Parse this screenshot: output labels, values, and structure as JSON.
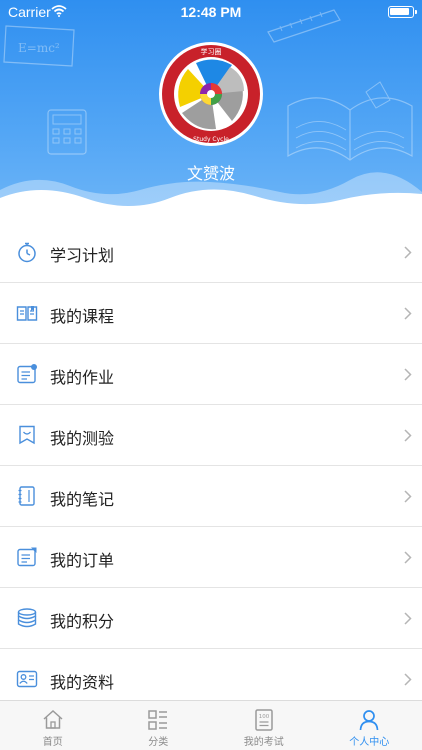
{
  "status_bar": {
    "carrier": "Carrier",
    "time": "12:48 PM"
  },
  "profile": {
    "username": "文赟波",
    "logo_text_cn": "学习圈",
    "logo_text_en": "Study Cycle"
  },
  "decorations": {
    "formula": "E=mc²"
  },
  "menu": {
    "items": [
      {
        "label": "学习计划",
        "icon": "stopwatch-icon"
      },
      {
        "label": "我的课程",
        "icon": "open-book-icon"
      },
      {
        "label": "我的作业",
        "icon": "homework-icon"
      },
      {
        "label": "我的测验",
        "icon": "bookmark-shield-icon"
      },
      {
        "label": "我的笔记",
        "icon": "notebook-icon"
      },
      {
        "label": "我的订单",
        "icon": "order-icon"
      },
      {
        "label": "我的积分",
        "icon": "coins-stack-icon"
      },
      {
        "label": "我的资料",
        "icon": "id-card-icon"
      }
    ]
  },
  "tabbar": {
    "tabs": [
      {
        "label": "首页",
        "icon": "home-icon"
      },
      {
        "label": "分类",
        "icon": "category-icon"
      },
      {
        "label": "我的考试",
        "icon": "exam-paper-icon"
      },
      {
        "label": "个人中心",
        "icon": "person-icon"
      }
    ],
    "active_index": 3
  },
  "colors": {
    "primary": "#2f8ff0",
    "icon": "#4a8fdc",
    "text": "#222222",
    "divider": "#e4e4e4",
    "tab_inactive": "#8a8a8a"
  }
}
